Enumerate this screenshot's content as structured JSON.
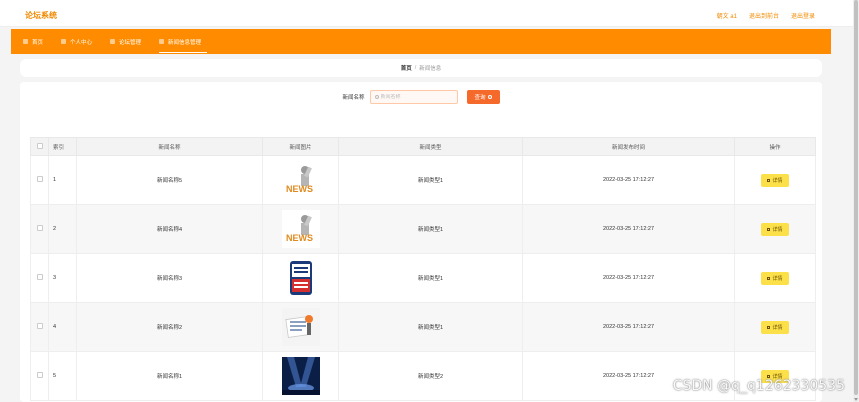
{
  "header": {
    "brand": "论坛系统",
    "user": "朝文 a1",
    "back_to_admin": "退出到前台",
    "logout": "退出登录"
  },
  "nav": {
    "items": [
      {
        "label": "首页"
      },
      {
        "label": "个人中心"
      },
      {
        "label": "论坛管理"
      },
      {
        "label": "新闻信息管理"
      }
    ]
  },
  "breadcrumb": {
    "home": "首页",
    "separator": "/",
    "current": "新闻信息"
  },
  "search": {
    "label": "新闻名称",
    "placeholder": "新闻名称",
    "button": "查询"
  },
  "table": {
    "columns": [
      "索引",
      "新闻名称",
      "新闻图片",
      "新闻类型",
      "新闻发布时间",
      "操作"
    ],
    "rows": [
      {
        "index": "1",
        "name": "新闻名称5",
        "image": "news-3d-figure",
        "type": "新闻类型1",
        "time": "2022-03-25 17:12:27",
        "action": "详情"
      },
      {
        "index": "2",
        "name": "新闻名称4",
        "image": "news-3d-figure",
        "type": "新闻类型1",
        "time": "2022-03-25 17:12:27",
        "action": "详情"
      },
      {
        "index": "3",
        "name": "新闻名称3",
        "image": "cctv-news-logo",
        "type": "新闻类型1",
        "time": "2022-03-25 17:12:27",
        "action": "详情"
      },
      {
        "index": "4",
        "name": "新闻名称2",
        "image": "newspaper-illustration",
        "type": "新闻类型1",
        "time": "2022-03-25 17:12:27",
        "action": "详情"
      },
      {
        "index": "5",
        "name": "新闻名称1",
        "image": "stage-spotlight",
        "type": "新闻类型2",
        "time": "2022-03-25 17:12:27",
        "action": "详情"
      }
    ]
  },
  "watermark": "CSDN @q_q1262330535",
  "colors": {
    "accent": "#ff8c00",
    "brand": "#f08a00",
    "query_button": "#f56a2a",
    "detail_button": "#fbe04a"
  }
}
